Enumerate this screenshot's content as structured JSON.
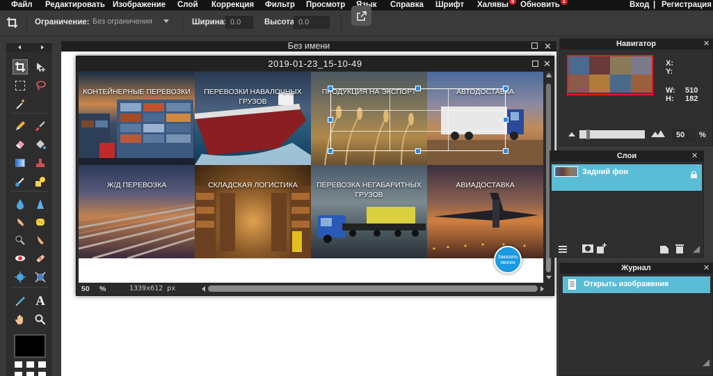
{
  "menu": {
    "items": [
      "Файл",
      "Редактировать",
      "Изображение",
      "Слой",
      "Коррекция",
      "Фильтр",
      "Просмотр",
      "Язык",
      "Справка",
      "Шрифт",
      "Халявы",
      "Обновить"
    ],
    "freebies_badge": "5",
    "update_badge": "1",
    "login": "Вход",
    "separator": "|",
    "register": "Регистрация"
  },
  "options": {
    "constraint_label": "Ограничение:",
    "constraint_value": "Без ограничения",
    "width_label": "Ширина:",
    "width_value": "0.0",
    "height_label": "Высота:",
    "height_value": "0.0"
  },
  "workspace": {
    "background_title": "Без имени"
  },
  "document": {
    "title": "2019-01-23_15-10-49",
    "zoom": "50",
    "zoom_unit": "%",
    "dimensions": "1339x612 px",
    "order_badge": "Заказать звонок",
    "tiles": [
      {
        "label": "КОНТЕЙНЕРНЫЕ ПЕРЕВОЗКИ"
      },
      {
        "label": "ПЕРЕВОЗКИ НАВАЛОЧНЫХ ГРУЗОВ"
      },
      {
        "label": "ПРОДУКЦИЯ НА ЭКСПОРТ"
      },
      {
        "label": "АВТОДОСТАВКА"
      },
      {
        "label": "Ж/Д ПЕРЕВОЗКА"
      },
      {
        "label": "СКЛАДСКАЯ ЛОГИСТИКА"
      },
      {
        "label": "ПЕРЕВОЗКА НЕГАБАРИТНЫХ ГРУЗОВ"
      },
      {
        "label": "АВИАДОСТАВКА"
      }
    ]
  },
  "navigator": {
    "title": "Навигатор",
    "x_label": "X:",
    "y_label": "Y:",
    "w_label": "W:",
    "w_value": "510",
    "h_label": "H:",
    "h_value": "182",
    "zoom_value": "50",
    "zoom_unit": "%"
  },
  "layers": {
    "title": "Слои",
    "items": [
      {
        "name": "Задний фон"
      }
    ]
  },
  "history": {
    "title": "Журнал",
    "items": [
      {
        "name": "Открыть изображение"
      }
    ]
  },
  "colors": {
    "accent": "#5bbcd6",
    "menu_bg": "#141414",
    "panel_bg": "#2f2f2f",
    "selection_handle": "#2a8ee0",
    "badge_red": "#e01d1d"
  }
}
